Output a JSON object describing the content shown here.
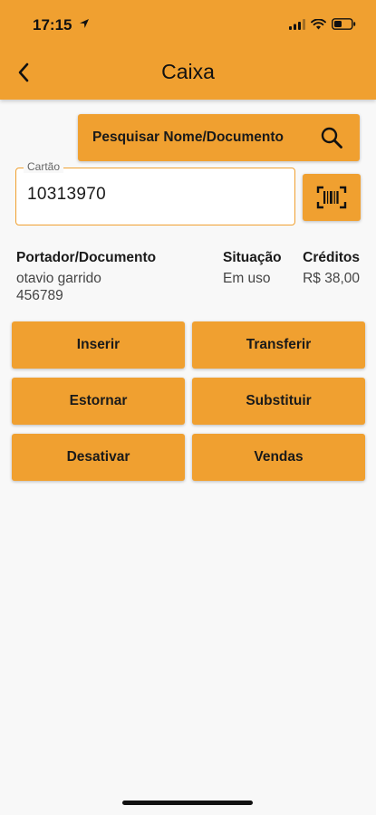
{
  "status_bar": {
    "time": "17:15"
  },
  "header": {
    "title": "Caixa",
    "back_icon": "chevron-left-icon"
  },
  "search": {
    "label": "Pesquisar Nome/Documento",
    "icon": "search-icon"
  },
  "card": {
    "label": "Cartão",
    "value": "10313970",
    "scan_icon": "barcode-scan-icon"
  },
  "holder": {
    "header": "Portador/Documento",
    "name": "otavio garrido",
    "document": "456789"
  },
  "situation": {
    "header": "Situação",
    "value": "Em uso"
  },
  "credits": {
    "header": "Créditos",
    "value": "R$ 38,00"
  },
  "actions": [
    {
      "label": "Inserir"
    },
    {
      "label": "Transferir"
    },
    {
      "label": "Estornar"
    },
    {
      "label": "Substituir"
    },
    {
      "label": "Desativar"
    },
    {
      "label": "Vendas"
    }
  ],
  "colors": {
    "accent": "#f0a030",
    "background": "#f8f8f8"
  }
}
